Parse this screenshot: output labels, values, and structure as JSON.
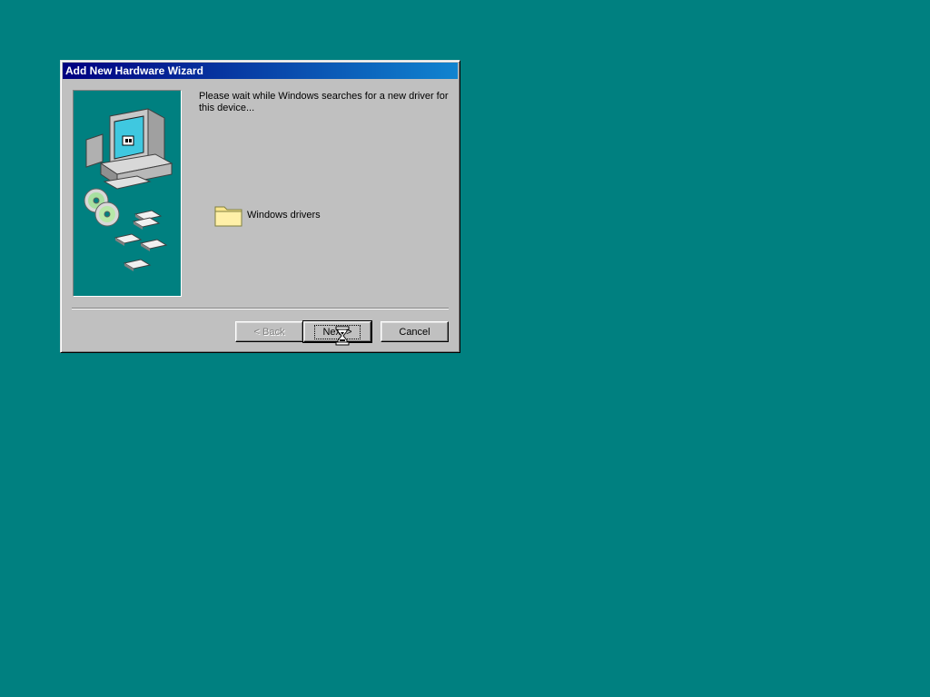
{
  "window": {
    "title": "Add New Hardware Wizard"
  },
  "content": {
    "message": "Please wait while Windows searches for a new driver for this device...",
    "folder_label": "Windows drivers",
    "folder_icon": "folder-icon",
    "illustration_icon": "computer-illustration-icon"
  },
  "buttons": {
    "back_label": "< Back",
    "next_label": "Next >",
    "cancel_label": "Cancel"
  },
  "cursor": {
    "icon": "hourglass-icon"
  },
  "colors": {
    "desktop": "#008080",
    "titlebar_start": "#000080",
    "titlebar_end": "#1084d0",
    "face": "#c0c0c0"
  }
}
